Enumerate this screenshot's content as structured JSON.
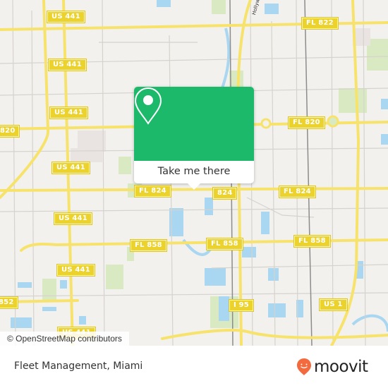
{
  "map": {
    "attribution": "© OpenStreetMap contributors",
    "waterway_label": "Hollywood Canal",
    "road_shields": [
      {
        "id": "us441-a",
        "label": "US 441"
      },
      {
        "id": "us441-b",
        "label": "US 441"
      },
      {
        "id": "us441-c",
        "label": "US 441"
      },
      {
        "id": "us441-d",
        "label": "US 441"
      },
      {
        "id": "us441-e",
        "label": "US 441"
      },
      {
        "id": "us441-f",
        "label": "US 441"
      },
      {
        "id": "us441-g",
        "label": "US 441"
      },
      {
        "id": "fl822",
        "label": "FL 822"
      },
      {
        "id": "fl820-left",
        "label": "820"
      },
      {
        "id": "fl820",
        "label": "FL 820"
      },
      {
        "id": "fl824-a",
        "label": "FL 824"
      },
      {
        "id": "fl824-b",
        "label": "824"
      },
      {
        "id": "fl824-c",
        "label": "FL 824"
      },
      {
        "id": "fl858-a",
        "label": "FL 858"
      },
      {
        "id": "fl858-b",
        "label": "FL 858"
      },
      {
        "id": "fl858-c",
        "label": "FL 858"
      },
      {
        "id": "fl852",
        "label": "852"
      },
      {
        "id": "i95",
        "label": "I 95"
      },
      {
        "id": "us1",
        "label": "US 1"
      }
    ],
    "colors": {
      "land": "#f2f1ee",
      "road_major": "#f7e36c",
      "water": "#a9d6f0",
      "park": "#d9eac2",
      "popup_green": "#1db96a"
    }
  },
  "popup": {
    "action_label": "Take me there",
    "icon": "map-pin-icon"
  },
  "footer": {
    "place_name": "Fleet Management, Miami",
    "brand": "moovit",
    "brand_color": "#f26a3d"
  }
}
